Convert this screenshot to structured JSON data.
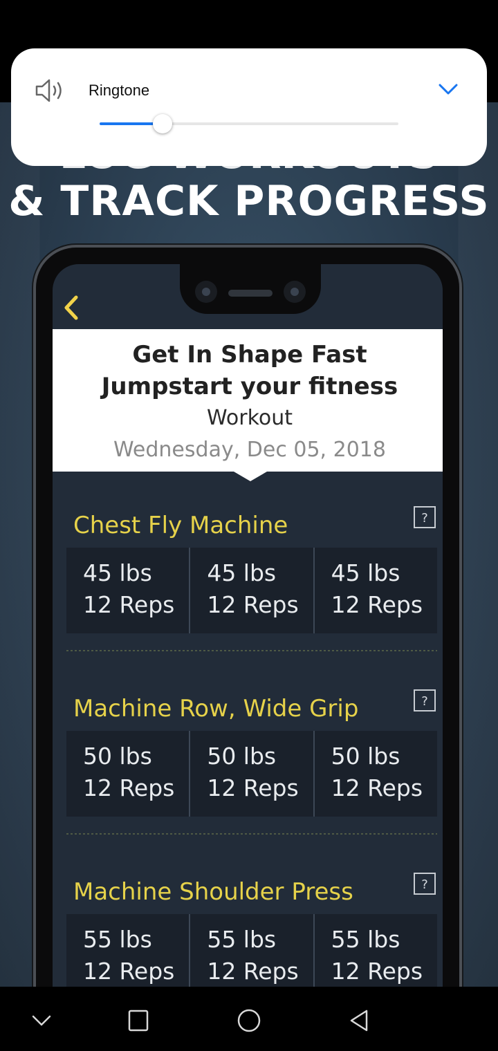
{
  "volume_panel": {
    "label": "Ringtone",
    "level_fraction": 0.21,
    "accent_color": "#1976f0",
    "icons": {
      "speaker": "speaker-icon",
      "expand": "chevron-down-icon"
    }
  },
  "promo": {
    "headline": "& TRACK PROGRESS",
    "headline_partial": "LOG WORKOUTS"
  },
  "workout": {
    "title_line1": "Get In Shape Fast",
    "title_line2": "Jumpstart your fitness",
    "label": "Workout",
    "date": "Wednesday, Dec 05, 2018"
  },
  "exercises": [
    {
      "name": "Chest Fly Machine",
      "help": "?",
      "sets": [
        {
          "weight": "45 lbs",
          "reps": "12 Reps"
        },
        {
          "weight": "45 lbs",
          "reps": "12 Reps"
        },
        {
          "weight": "45 lbs",
          "reps": "12 Reps"
        }
      ]
    },
    {
      "name": "Machine Row, Wide Grip",
      "help": "?",
      "sets": [
        {
          "weight": "50 lbs",
          "reps": "12 Reps"
        },
        {
          "weight": "50 lbs",
          "reps": "12 Reps"
        },
        {
          "weight": "50 lbs",
          "reps": "12 Reps"
        }
      ]
    },
    {
      "name": "Machine Shoulder Press",
      "help": "?",
      "sets": [
        {
          "weight": "55 lbs",
          "reps": "12 Reps"
        },
        {
          "weight": "55 lbs",
          "reps": "12 Reps"
        },
        {
          "weight": "55 lbs",
          "reps": "12 Reps"
        }
      ]
    }
  ],
  "nav_bar": {
    "buttons": [
      "chevron-down-icon",
      "recents-icon",
      "home-icon",
      "back-icon"
    ]
  }
}
